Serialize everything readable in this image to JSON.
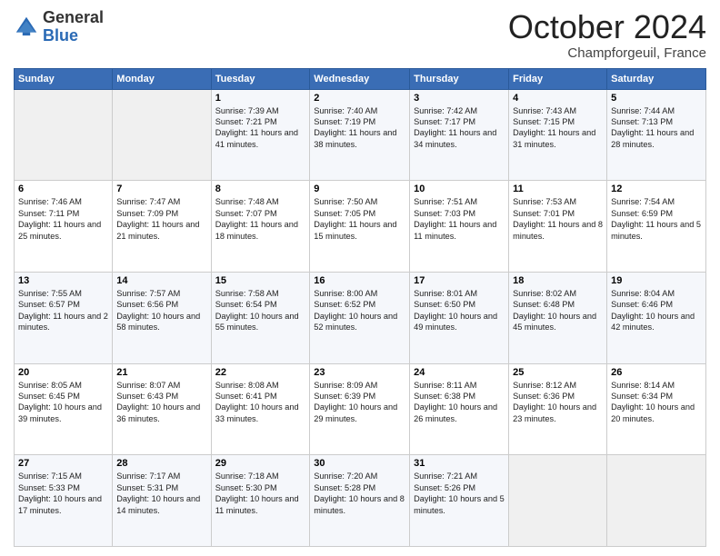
{
  "header": {
    "logo": {
      "general": "General",
      "blue": "Blue"
    },
    "month": "October 2024",
    "location": "Champforgeuil, France"
  },
  "days_of_week": [
    "Sunday",
    "Monday",
    "Tuesday",
    "Wednesday",
    "Thursday",
    "Friday",
    "Saturday"
  ],
  "weeks": [
    [
      {
        "day": "",
        "sunrise": "",
        "sunset": "",
        "daylight": "",
        "empty": true
      },
      {
        "day": "",
        "sunrise": "",
        "sunset": "",
        "daylight": "",
        "empty": true
      },
      {
        "day": "1",
        "sunrise": "Sunrise: 7:39 AM",
        "sunset": "Sunset: 7:21 PM",
        "daylight": "Daylight: 11 hours and 41 minutes."
      },
      {
        "day": "2",
        "sunrise": "Sunrise: 7:40 AM",
        "sunset": "Sunset: 7:19 PM",
        "daylight": "Daylight: 11 hours and 38 minutes."
      },
      {
        "day": "3",
        "sunrise": "Sunrise: 7:42 AM",
        "sunset": "Sunset: 7:17 PM",
        "daylight": "Daylight: 11 hours and 34 minutes."
      },
      {
        "day": "4",
        "sunrise": "Sunrise: 7:43 AM",
        "sunset": "Sunset: 7:15 PM",
        "daylight": "Daylight: 11 hours and 31 minutes."
      },
      {
        "day": "5",
        "sunrise": "Sunrise: 7:44 AM",
        "sunset": "Sunset: 7:13 PM",
        "daylight": "Daylight: 11 hours and 28 minutes."
      }
    ],
    [
      {
        "day": "6",
        "sunrise": "Sunrise: 7:46 AM",
        "sunset": "Sunset: 7:11 PM",
        "daylight": "Daylight: 11 hours and 25 minutes."
      },
      {
        "day": "7",
        "sunrise": "Sunrise: 7:47 AM",
        "sunset": "Sunset: 7:09 PM",
        "daylight": "Daylight: 11 hours and 21 minutes."
      },
      {
        "day": "8",
        "sunrise": "Sunrise: 7:48 AM",
        "sunset": "Sunset: 7:07 PM",
        "daylight": "Daylight: 11 hours and 18 minutes."
      },
      {
        "day": "9",
        "sunrise": "Sunrise: 7:50 AM",
        "sunset": "Sunset: 7:05 PM",
        "daylight": "Daylight: 11 hours and 15 minutes."
      },
      {
        "day": "10",
        "sunrise": "Sunrise: 7:51 AM",
        "sunset": "Sunset: 7:03 PM",
        "daylight": "Daylight: 11 hours and 11 minutes."
      },
      {
        "day": "11",
        "sunrise": "Sunrise: 7:53 AM",
        "sunset": "Sunset: 7:01 PM",
        "daylight": "Daylight: 11 hours and 8 minutes."
      },
      {
        "day": "12",
        "sunrise": "Sunrise: 7:54 AM",
        "sunset": "Sunset: 6:59 PM",
        "daylight": "Daylight: 11 hours and 5 minutes."
      }
    ],
    [
      {
        "day": "13",
        "sunrise": "Sunrise: 7:55 AM",
        "sunset": "Sunset: 6:57 PM",
        "daylight": "Daylight: 11 hours and 2 minutes."
      },
      {
        "day": "14",
        "sunrise": "Sunrise: 7:57 AM",
        "sunset": "Sunset: 6:56 PM",
        "daylight": "Daylight: 10 hours and 58 minutes."
      },
      {
        "day": "15",
        "sunrise": "Sunrise: 7:58 AM",
        "sunset": "Sunset: 6:54 PM",
        "daylight": "Daylight: 10 hours and 55 minutes."
      },
      {
        "day": "16",
        "sunrise": "Sunrise: 8:00 AM",
        "sunset": "Sunset: 6:52 PM",
        "daylight": "Daylight: 10 hours and 52 minutes."
      },
      {
        "day": "17",
        "sunrise": "Sunrise: 8:01 AM",
        "sunset": "Sunset: 6:50 PM",
        "daylight": "Daylight: 10 hours and 49 minutes."
      },
      {
        "day": "18",
        "sunrise": "Sunrise: 8:02 AM",
        "sunset": "Sunset: 6:48 PM",
        "daylight": "Daylight: 10 hours and 45 minutes."
      },
      {
        "day": "19",
        "sunrise": "Sunrise: 8:04 AM",
        "sunset": "Sunset: 6:46 PM",
        "daylight": "Daylight: 10 hours and 42 minutes."
      }
    ],
    [
      {
        "day": "20",
        "sunrise": "Sunrise: 8:05 AM",
        "sunset": "Sunset: 6:45 PM",
        "daylight": "Daylight: 10 hours and 39 minutes."
      },
      {
        "day": "21",
        "sunrise": "Sunrise: 8:07 AM",
        "sunset": "Sunset: 6:43 PM",
        "daylight": "Daylight: 10 hours and 36 minutes."
      },
      {
        "day": "22",
        "sunrise": "Sunrise: 8:08 AM",
        "sunset": "Sunset: 6:41 PM",
        "daylight": "Daylight: 10 hours and 33 minutes."
      },
      {
        "day": "23",
        "sunrise": "Sunrise: 8:09 AM",
        "sunset": "Sunset: 6:39 PM",
        "daylight": "Daylight: 10 hours and 29 minutes."
      },
      {
        "day": "24",
        "sunrise": "Sunrise: 8:11 AM",
        "sunset": "Sunset: 6:38 PM",
        "daylight": "Daylight: 10 hours and 26 minutes."
      },
      {
        "day": "25",
        "sunrise": "Sunrise: 8:12 AM",
        "sunset": "Sunset: 6:36 PM",
        "daylight": "Daylight: 10 hours and 23 minutes."
      },
      {
        "day": "26",
        "sunrise": "Sunrise: 8:14 AM",
        "sunset": "Sunset: 6:34 PM",
        "daylight": "Daylight: 10 hours and 20 minutes."
      }
    ],
    [
      {
        "day": "27",
        "sunrise": "Sunrise: 7:15 AM",
        "sunset": "Sunset: 5:33 PM",
        "daylight": "Daylight: 10 hours and 17 minutes."
      },
      {
        "day": "28",
        "sunrise": "Sunrise: 7:17 AM",
        "sunset": "Sunset: 5:31 PM",
        "daylight": "Daylight: 10 hours and 14 minutes."
      },
      {
        "day": "29",
        "sunrise": "Sunrise: 7:18 AM",
        "sunset": "Sunset: 5:30 PM",
        "daylight": "Daylight: 10 hours and 11 minutes."
      },
      {
        "day": "30",
        "sunrise": "Sunrise: 7:20 AM",
        "sunset": "Sunset: 5:28 PM",
        "daylight": "Daylight: 10 hours and 8 minutes."
      },
      {
        "day": "31",
        "sunrise": "Sunrise: 7:21 AM",
        "sunset": "Sunset: 5:26 PM",
        "daylight": "Daylight: 10 hours and 5 minutes."
      },
      {
        "day": "",
        "sunrise": "",
        "sunset": "",
        "daylight": "",
        "empty": true
      },
      {
        "day": "",
        "sunrise": "",
        "sunset": "",
        "daylight": "",
        "empty": true
      }
    ]
  ]
}
